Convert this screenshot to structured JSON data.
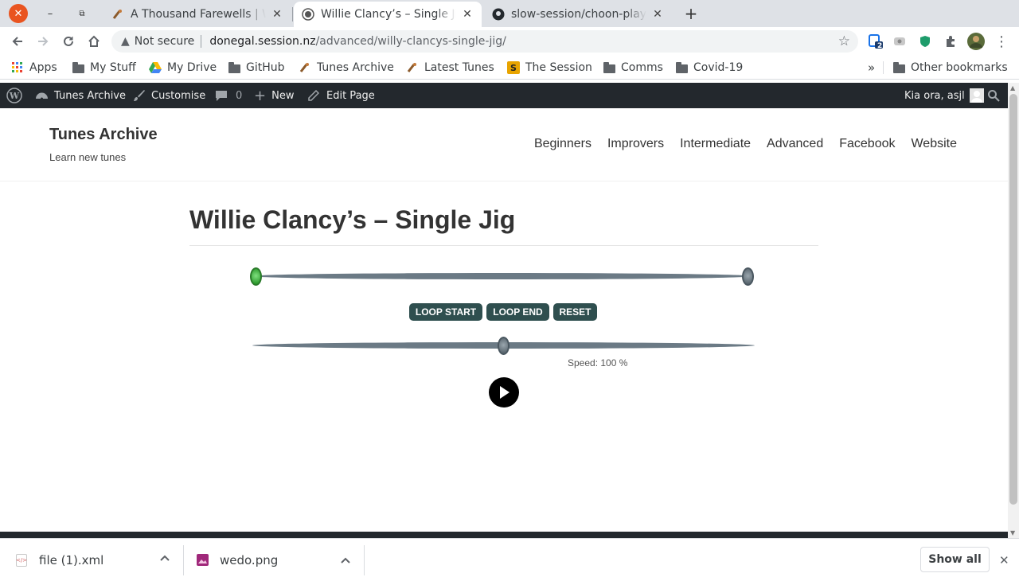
{
  "browser": {
    "tabs": [
      {
        "title": "A Thousand Farewells | Wexford",
        "active": false
      },
      {
        "title": "Willie Clancy’s – Single Jig",
        "active": true
      },
      {
        "title": "slow-session/choon-player",
        "active": false
      }
    ],
    "new_tab_symbol": "+",
    "address": {
      "security_label": "Not secure",
      "host": "donegal.session.nz",
      "path": "/advanced/willy-clancys-single-jig/"
    },
    "extension_badge": "2",
    "bookmarks": [
      {
        "label": "Apps",
        "icon": "apps-grid-icon"
      },
      {
        "label": "My Stuff",
        "icon": "folder-icon"
      },
      {
        "label": "My Drive",
        "icon": "drive-icon"
      },
      {
        "label": "GitHub",
        "icon": "folder-icon"
      },
      {
        "label": "Tunes Archive",
        "icon": "fiddle-icon"
      },
      {
        "label": "Latest Tunes",
        "icon": "fiddle-icon"
      },
      {
        "label": "The Session",
        "icon": "session-s-icon"
      },
      {
        "label": "Comms",
        "icon": "folder-icon"
      },
      {
        "label": "Covid-19",
        "icon": "folder-icon"
      }
    ],
    "bookmarks_overflow": "»",
    "other_bookmarks": "Other bookmarks"
  },
  "adminbar": {
    "site_name": "Tunes Archive",
    "customise": "Customise",
    "comments_count": "0",
    "new": "New",
    "edit_page": "Edit Page",
    "greeting": "Kia ora, asjl"
  },
  "site": {
    "title": "Tunes Archive",
    "description": "Learn new tunes",
    "nav": [
      "Beginners",
      "Improvers",
      "Intermediate",
      "Advanced",
      "Facebook",
      "Website"
    ]
  },
  "entry": {
    "title": "Willie Clancy’s – Single Jig"
  },
  "player": {
    "loop_start_label": "LOOP START",
    "loop_end_label": "LOOP END",
    "reset_label": "RESET",
    "speed_label": "Speed: 100 %",
    "speed_percent": 100,
    "loop_start_fraction": 0.0,
    "loop_end_fraction": 1.0,
    "colors": {
      "start_handle": "#2aa02a",
      "button_bg": "#2f4f4f",
      "track": "#6b7a85"
    }
  },
  "downloads": [
    {
      "filename": "file (1).xml",
      "icon": "xml-file-icon"
    },
    {
      "filename": "wedo.png",
      "icon": "image-file-icon"
    }
  ],
  "show_all_label": "Show all"
}
